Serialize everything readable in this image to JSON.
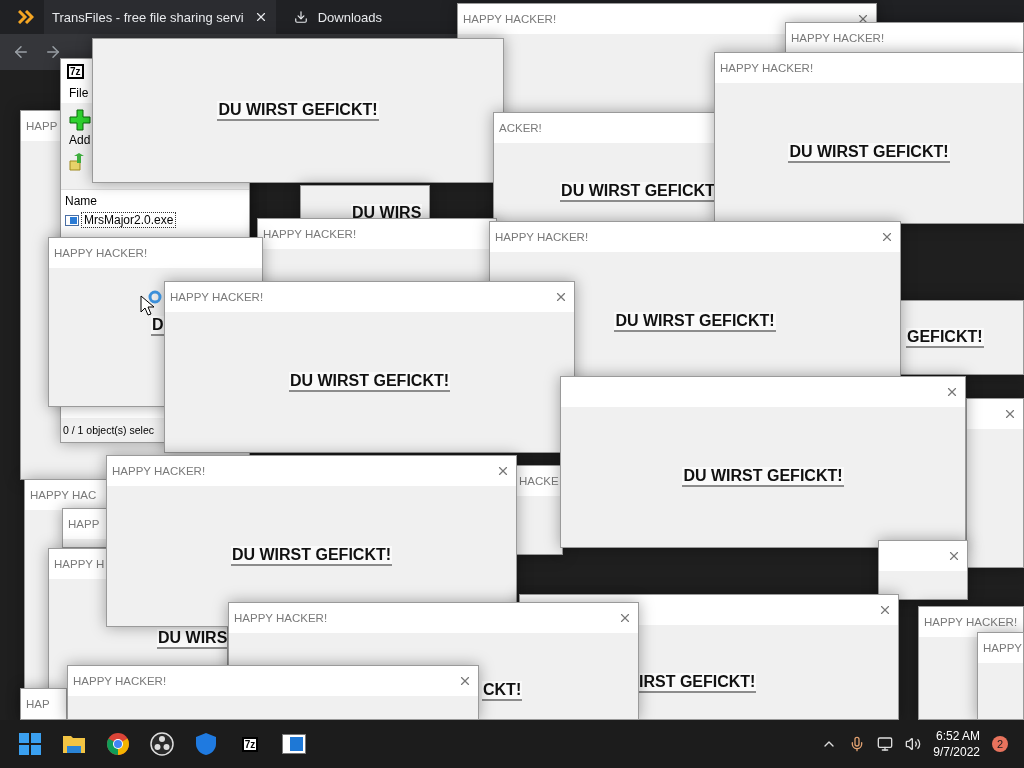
{
  "browser": {
    "tabs": [
      {
        "label": "TransFiles - free file sharing servi",
        "selected": true
      },
      {
        "label": "Downloads",
        "selected": false
      }
    ]
  },
  "windows": [
    {
      "kind": "popup",
      "title": "HAPPY HACKER!"
    },
    {
      "kind": "popup",
      "title": "HAPPY HACKER!"
    },
    {
      "kind": "popup",
      "title": "HAPP"
    },
    {
      "kind": "archiver",
      "logo": "7z",
      "menu": [
        "File"
      ],
      "toolbar": [
        "Add"
      ],
      "column": "Name",
      "files": [
        "MrsMajor2.0.exe"
      ],
      "status": "0 / 1 object(s) selec"
    },
    {
      "kind": "popup",
      "message": "DU WIRST GEFICKT!"
    },
    {
      "kind": "popup",
      "title": "ACKER!",
      "message": "DU WIRST GEFICKT"
    },
    {
      "kind": "popup",
      "message": "DU WIRS"
    },
    {
      "kind": "popup",
      "title": "HAPPY HACKER!"
    },
    {
      "kind": "popup",
      "title": "HAPPY HACKER!",
      "message": "D"
    },
    {
      "kind": "popup",
      "title": "HAPPY HACKER!",
      "message": "DU WIRST GEFICKT!"
    },
    {
      "kind": "popup",
      "message": "GEFICKT!"
    },
    {
      "kind": "popup",
      "title": "HAPPY HACKER!",
      "message": "DU WIRST GEFICKT!"
    },
    {
      "kind": "popup"
    },
    {
      "kind": "popup",
      "title": "HAPPY HACKER!",
      "message": "DU WIRST GEFICKT!"
    },
    {
      "kind": "popup",
      "title": "HAPPY HAC"
    },
    {
      "kind": "popup",
      "title": "HAPP"
    },
    {
      "kind": "popup",
      "title": "HAPPY H",
      "message": "DU WIRS"
    },
    {
      "kind": "popup",
      "title": "HAP"
    },
    {
      "kind": "popup",
      "title": "HACKE"
    },
    {
      "kind": "popup",
      "title": "HAPPY HACKER!",
      "message": "DU WIRST GEFICKT!"
    },
    {
      "kind": "popup",
      "message": "DU WIRST GEFICKT!"
    },
    {
      "kind": "popup"
    },
    {
      "kind": "popup",
      "message": "IRST GEFICKT!"
    },
    {
      "kind": "popup",
      "title": "HAPPY HACKER!",
      "message": "CKT!"
    },
    {
      "kind": "popup",
      "title": "HAPPY HACKER!"
    },
    {
      "kind": "popup",
      "title": "HAPPY HACKER!"
    },
    {
      "kind": "popup",
      "title": "HAPPY"
    }
  ],
  "taskbar": {
    "apps": [
      {
        "kind": "start"
      },
      {
        "kind": "folder"
      },
      {
        "kind": "chrome"
      },
      {
        "kind": "obs"
      },
      {
        "kind": "shield"
      },
      {
        "kind": "archiver",
        "logo": "7z"
      },
      {
        "kind": "app"
      }
    ],
    "time": "6:52 AM",
    "date": "9/7/2022",
    "badge": "2"
  }
}
